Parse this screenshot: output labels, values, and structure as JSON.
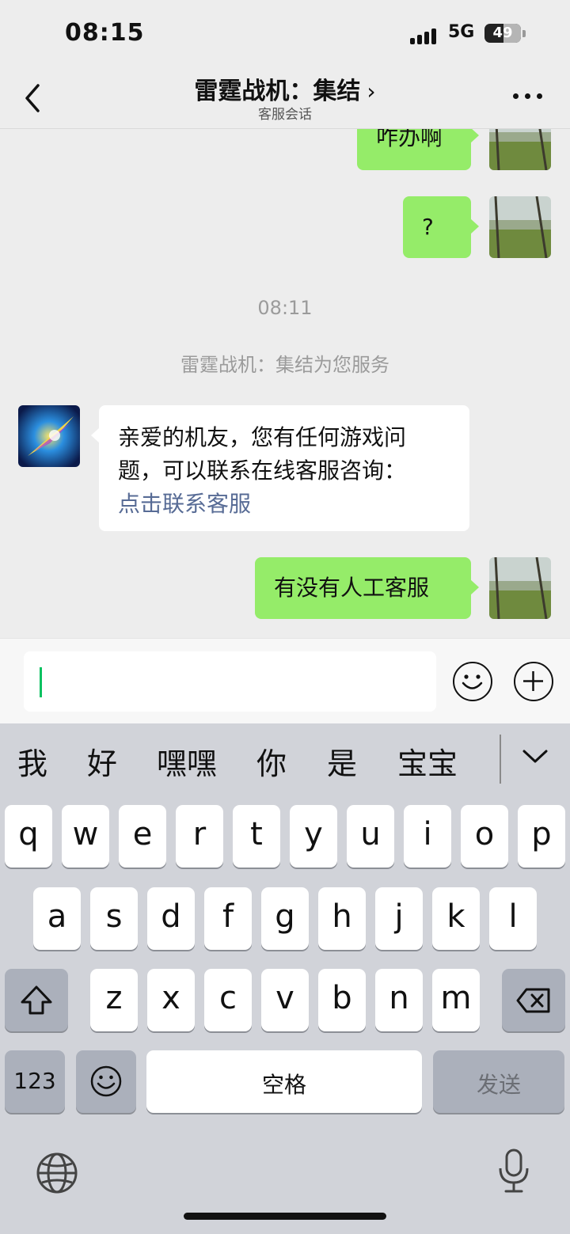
{
  "status_bar": {
    "time": "08:15",
    "network": "5G",
    "battery": "49"
  },
  "nav": {
    "title": "雷霆战机：集结",
    "subtitle": "客服会话"
  },
  "chat": {
    "messages_top": [
      {
        "from": "me",
        "text": "咋办啊"
      },
      {
        "from": "me",
        "text": "?"
      }
    ],
    "timestamp": "08:11",
    "system_notice": "雷霆战机：集结为您服务",
    "service_message": {
      "from": "service",
      "line1": "亲爱的机友，您有任何游戏问",
      "line2": "题，可以联系在线客服咨询：",
      "link": "点击联系客服"
    },
    "last_message": {
      "from": "me",
      "text": "有没有人工客服"
    }
  },
  "input": {
    "value": "",
    "emoji_icon": "emoji-icon",
    "plus_icon": "plus-icon"
  },
  "keyboard": {
    "candidates": [
      "我",
      "好",
      "嘿嘿",
      "你",
      "是",
      "宝宝"
    ],
    "row1": [
      "q",
      "w",
      "e",
      "r",
      "t",
      "y",
      "u",
      "i",
      "o",
      "p"
    ],
    "row2": [
      "a",
      "s",
      "d",
      "f",
      "g",
      "h",
      "j",
      "k",
      "l"
    ],
    "row3": [
      "z",
      "x",
      "c",
      "v",
      "b",
      "n",
      "m"
    ],
    "numbers_key": "123",
    "space_key": "空格",
    "send_key": "发送"
  },
  "colors": {
    "my_bubble": "#95ec69",
    "link": "#576b95",
    "caret": "#07c160"
  }
}
